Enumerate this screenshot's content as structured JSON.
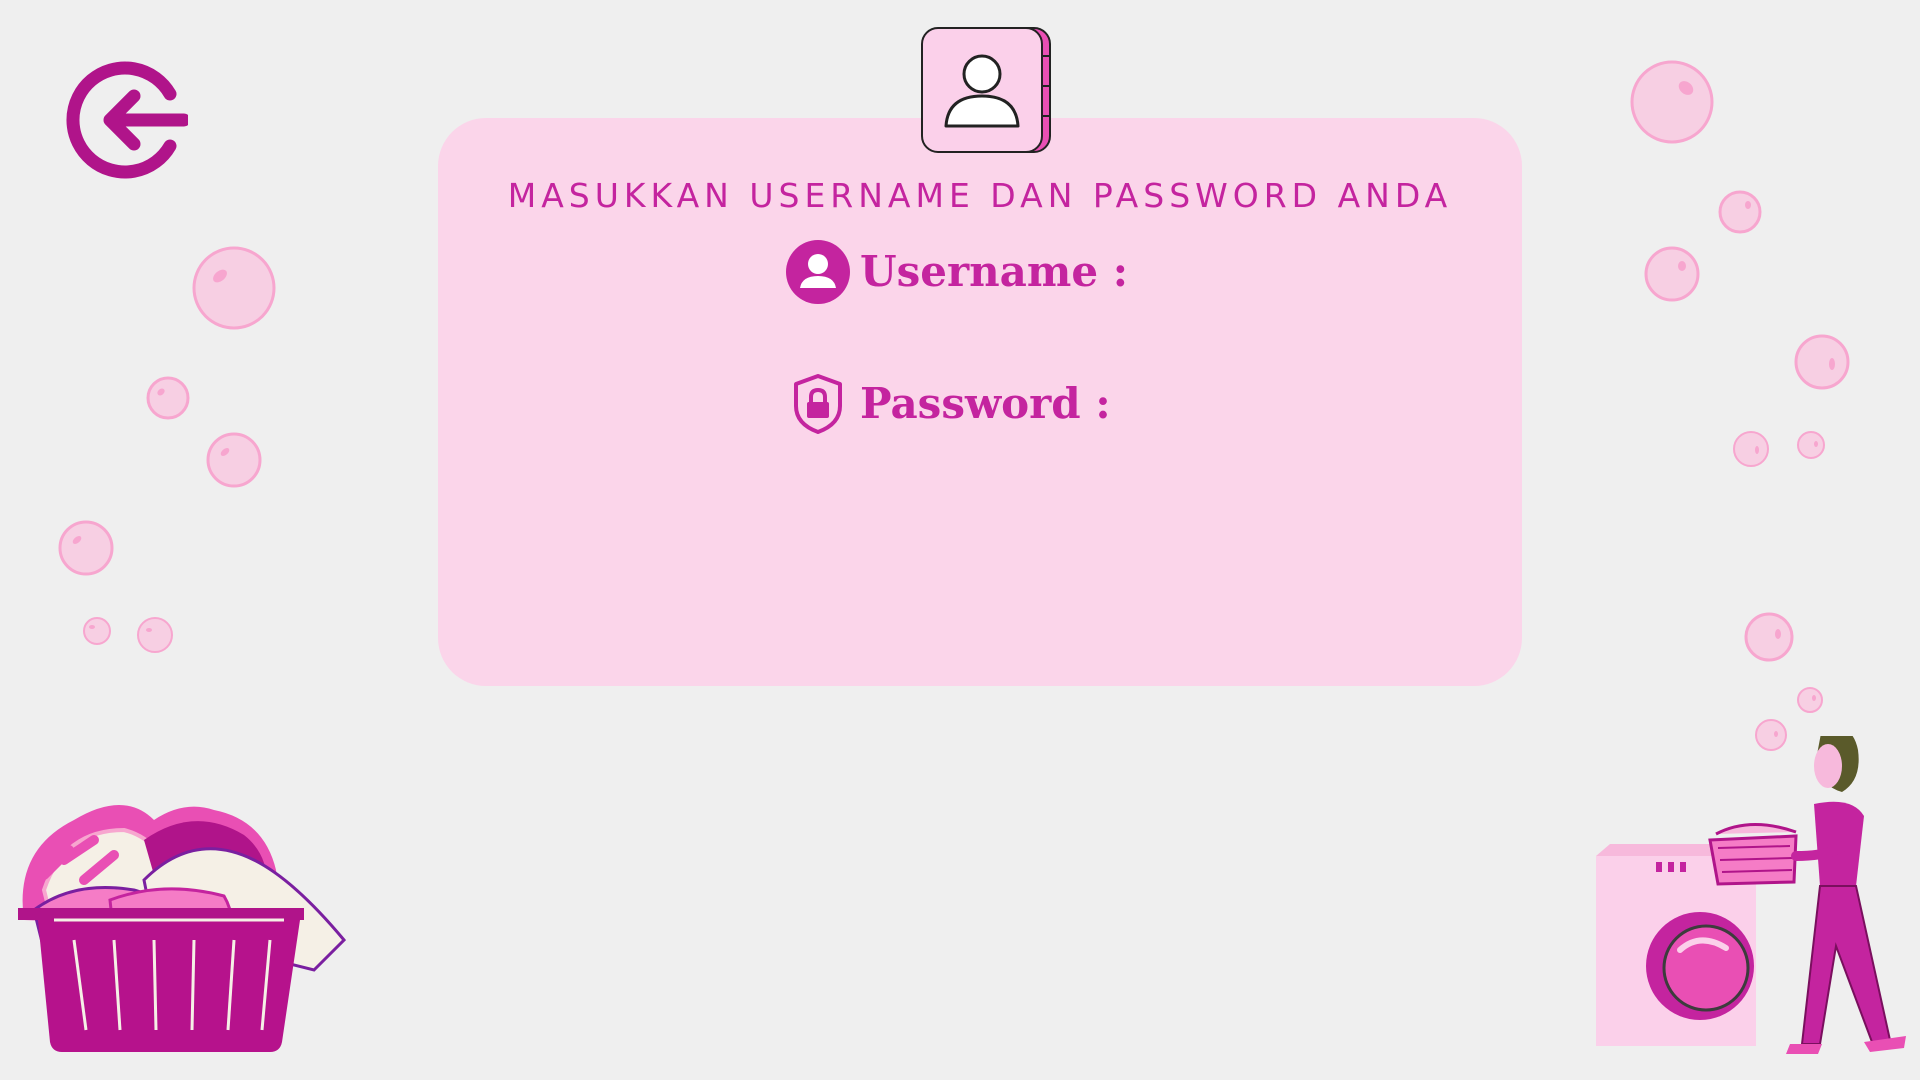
{
  "header": {
    "back_button_label": "back-arrow-icon"
  },
  "login_card": {
    "title": "Masukkan Username dan Password Anda",
    "username_label": "Username :",
    "password_label": "Password :",
    "username_value": "",
    "password_value": ""
  },
  "icons": {
    "back": "arrow-left-circle-icon",
    "avatar": "user-icon",
    "username": "user-circle-icon",
    "password": "shield-lock-icon"
  },
  "colors": {
    "background": "#efefef",
    "card": "#fbd5ea",
    "accent": "#c4249f",
    "dark_accent": "#b0148a",
    "bubble": "#f7a6cf"
  }
}
